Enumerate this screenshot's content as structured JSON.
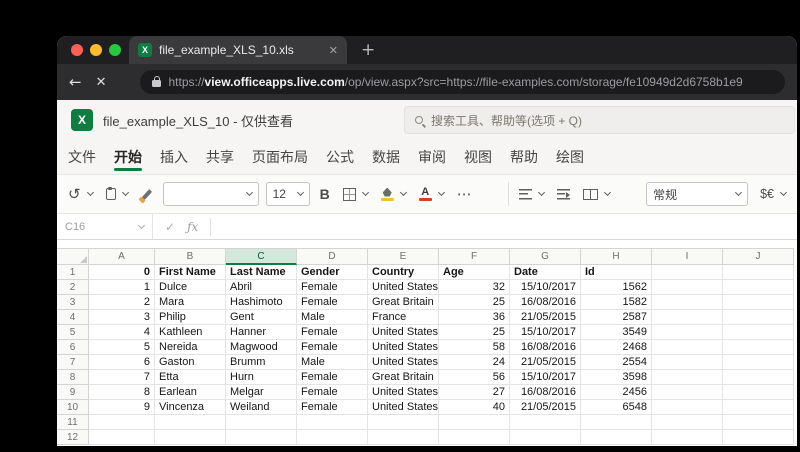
{
  "colors": {
    "excel_green": "#107c41",
    "selected_header_bg": "#d3e8db",
    "fill_swatch": "#f2c22e",
    "font_color_swatch": "#d43f2a",
    "traffic_lights": [
      "#ff5f57",
      "#febc2e",
      "#28c840"
    ]
  },
  "browser": {
    "tab_title": "file_example_XLS_10.xls",
    "tab_close_icon": "✕",
    "new_tab_icon": "+",
    "back_icon": "←",
    "stop_icon": "✕",
    "url": {
      "scheme": "https://",
      "domain": "view.officeapps.live.com",
      "path": "/op/view.aspx?src=https://file-examples.com/storage/fe10949d2d6758b1e9"
    }
  },
  "app": {
    "logo_letter": "X",
    "title": "file_example_XLS_10 - 仅供查看",
    "search_placeholder": "搜索工具、帮助等(选项 + Q)",
    "menus": [
      "文件",
      "开始",
      "插入",
      "共享",
      "页面布局",
      "公式",
      "数据",
      "审阅",
      "视图",
      "帮助",
      "绘图"
    ],
    "active_menu": "开始",
    "toolbar": {
      "undo_icon": "↺",
      "font_name": "",
      "font_size": "12",
      "bold_label": "B",
      "font_color_label": "A",
      "more_label": "⋯",
      "number_format": "常规",
      "currency_label": "$€"
    },
    "formula_bar": {
      "name_box": "C16",
      "check_icon": "✓",
      "fx_icon": "ƒx"
    }
  },
  "sheet": {
    "col_headers": [
      "A",
      "B",
      "C",
      "D",
      "E",
      "F",
      "G",
      "H",
      "I",
      "J"
    ],
    "selected_col": "C",
    "active_cell": "C16",
    "rows": [
      {
        "n": "1",
        "bold": true,
        "cells": [
          "0",
          "First Name",
          "Last Name",
          "Gender",
          "Country",
          "Age",
          "Date",
          "Id"
        ]
      },
      {
        "n": "2",
        "cells": [
          "1",
          "Dulce",
          "Abril",
          "Female",
          "United States",
          "32",
          "15/10/2017",
          "1562"
        ]
      },
      {
        "n": "3",
        "cells": [
          "2",
          "Mara",
          "Hashimoto",
          "Female",
          "Great Britain",
          "25",
          "16/08/2016",
          "1582"
        ]
      },
      {
        "n": "4",
        "cells": [
          "3",
          "Philip",
          "Gent",
          "Male",
          "France",
          "36",
          "21/05/2015",
          "2587"
        ]
      },
      {
        "n": "5",
        "cells": [
          "4",
          "Kathleen",
          "Hanner",
          "Female",
          "United States",
          "25",
          "15/10/2017",
          "3549"
        ]
      },
      {
        "n": "6",
        "cells": [
          "5",
          "Nereida",
          "Magwood",
          "Female",
          "United States",
          "58",
          "16/08/2016",
          "2468"
        ]
      },
      {
        "n": "7",
        "cells": [
          "6",
          "Gaston",
          "Brumm",
          "Male",
          "United States",
          "24",
          "21/05/2015",
          "2554"
        ]
      },
      {
        "n": "8",
        "cells": [
          "7",
          "Etta",
          "Hurn",
          "Female",
          "Great Britain",
          "56",
          "15/10/2017",
          "3598"
        ]
      },
      {
        "n": "9",
        "cells": [
          "8",
          "Earlean",
          "Melgar",
          "Female",
          "United States",
          "27",
          "16/08/2016",
          "2456"
        ]
      },
      {
        "n": "10",
        "cells": [
          "9",
          "Vincenza",
          "Weiland",
          "Female",
          "United States",
          "40",
          "21/05/2015",
          "6548"
        ]
      },
      {
        "n": "11",
        "cells": []
      },
      {
        "n": "12",
        "cells": []
      }
    ]
  }
}
